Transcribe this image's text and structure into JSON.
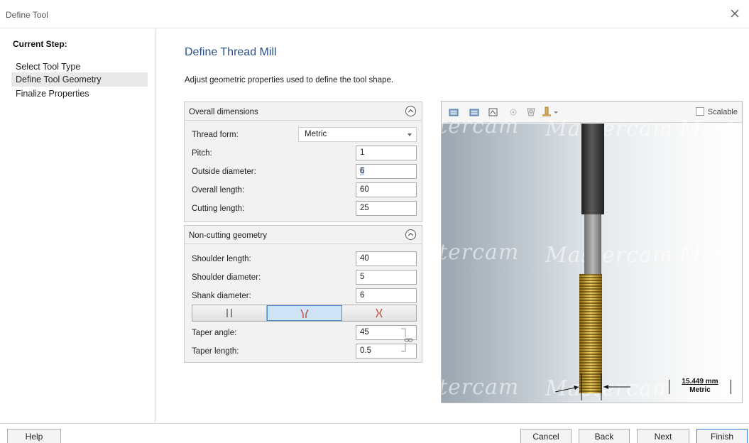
{
  "window": {
    "title": "Define Tool",
    "close_icon": "close-icon"
  },
  "sidebar": {
    "current_label": "Current Step:",
    "steps": [
      {
        "label": "Select Tool Type",
        "active": false
      },
      {
        "label": "Define Tool Geometry",
        "active": true
      },
      {
        "label": "Finalize Properties",
        "active": false
      }
    ]
  },
  "main": {
    "heading": "Define Thread Mill",
    "description": "Adjust geometric properties used to define the tool shape.",
    "heading_color": "#2a4f8a"
  },
  "overall": {
    "title": "Overall dimensions",
    "thread_form_label": "Thread form:",
    "thread_form_value": "Metric",
    "pitch_label": "Pitch:",
    "pitch_value": "1",
    "outside_diameter_label": "Outside diameter:",
    "outside_diameter_value": "6",
    "overall_length_label": "Overall length:",
    "overall_length_value": "60",
    "cutting_length_label": "Cutting length:",
    "cutting_length_value": "25"
  },
  "noncutting": {
    "title": "Non-cutting geometry",
    "shoulder_length_label": "Shoulder length:",
    "shoulder_length_value": "40",
    "shoulder_diameter_label": "Shoulder diameter:",
    "shoulder_diameter_value": "5",
    "shank_diameter_label": "Shank diameter:",
    "shank_diameter_value": "6",
    "shape_options": [
      "straight-shank-icon",
      "taper-in-icon",
      "taper-out-icon"
    ],
    "shape_selected": "taper-in-icon",
    "taper_angle_label": "Taper angle:",
    "taper_angle_value": "45",
    "taper_length_label": "Taper length:",
    "taper_length_value": "0.5"
  },
  "preview": {
    "scalable_label": "Scalable",
    "scale_value": "15.449 mm",
    "scale_unit": "Metric",
    "watermark": "Mastercam",
    "watermark_fragment": "tercam",
    "thread_color": "#d9b13a",
    "shank_color": "#3c3c3c"
  },
  "footer": {
    "help_label": "Help",
    "cancel_label": "Cancel",
    "back_label": "Back",
    "next_label": "Next",
    "finish_label": "Finish"
  }
}
